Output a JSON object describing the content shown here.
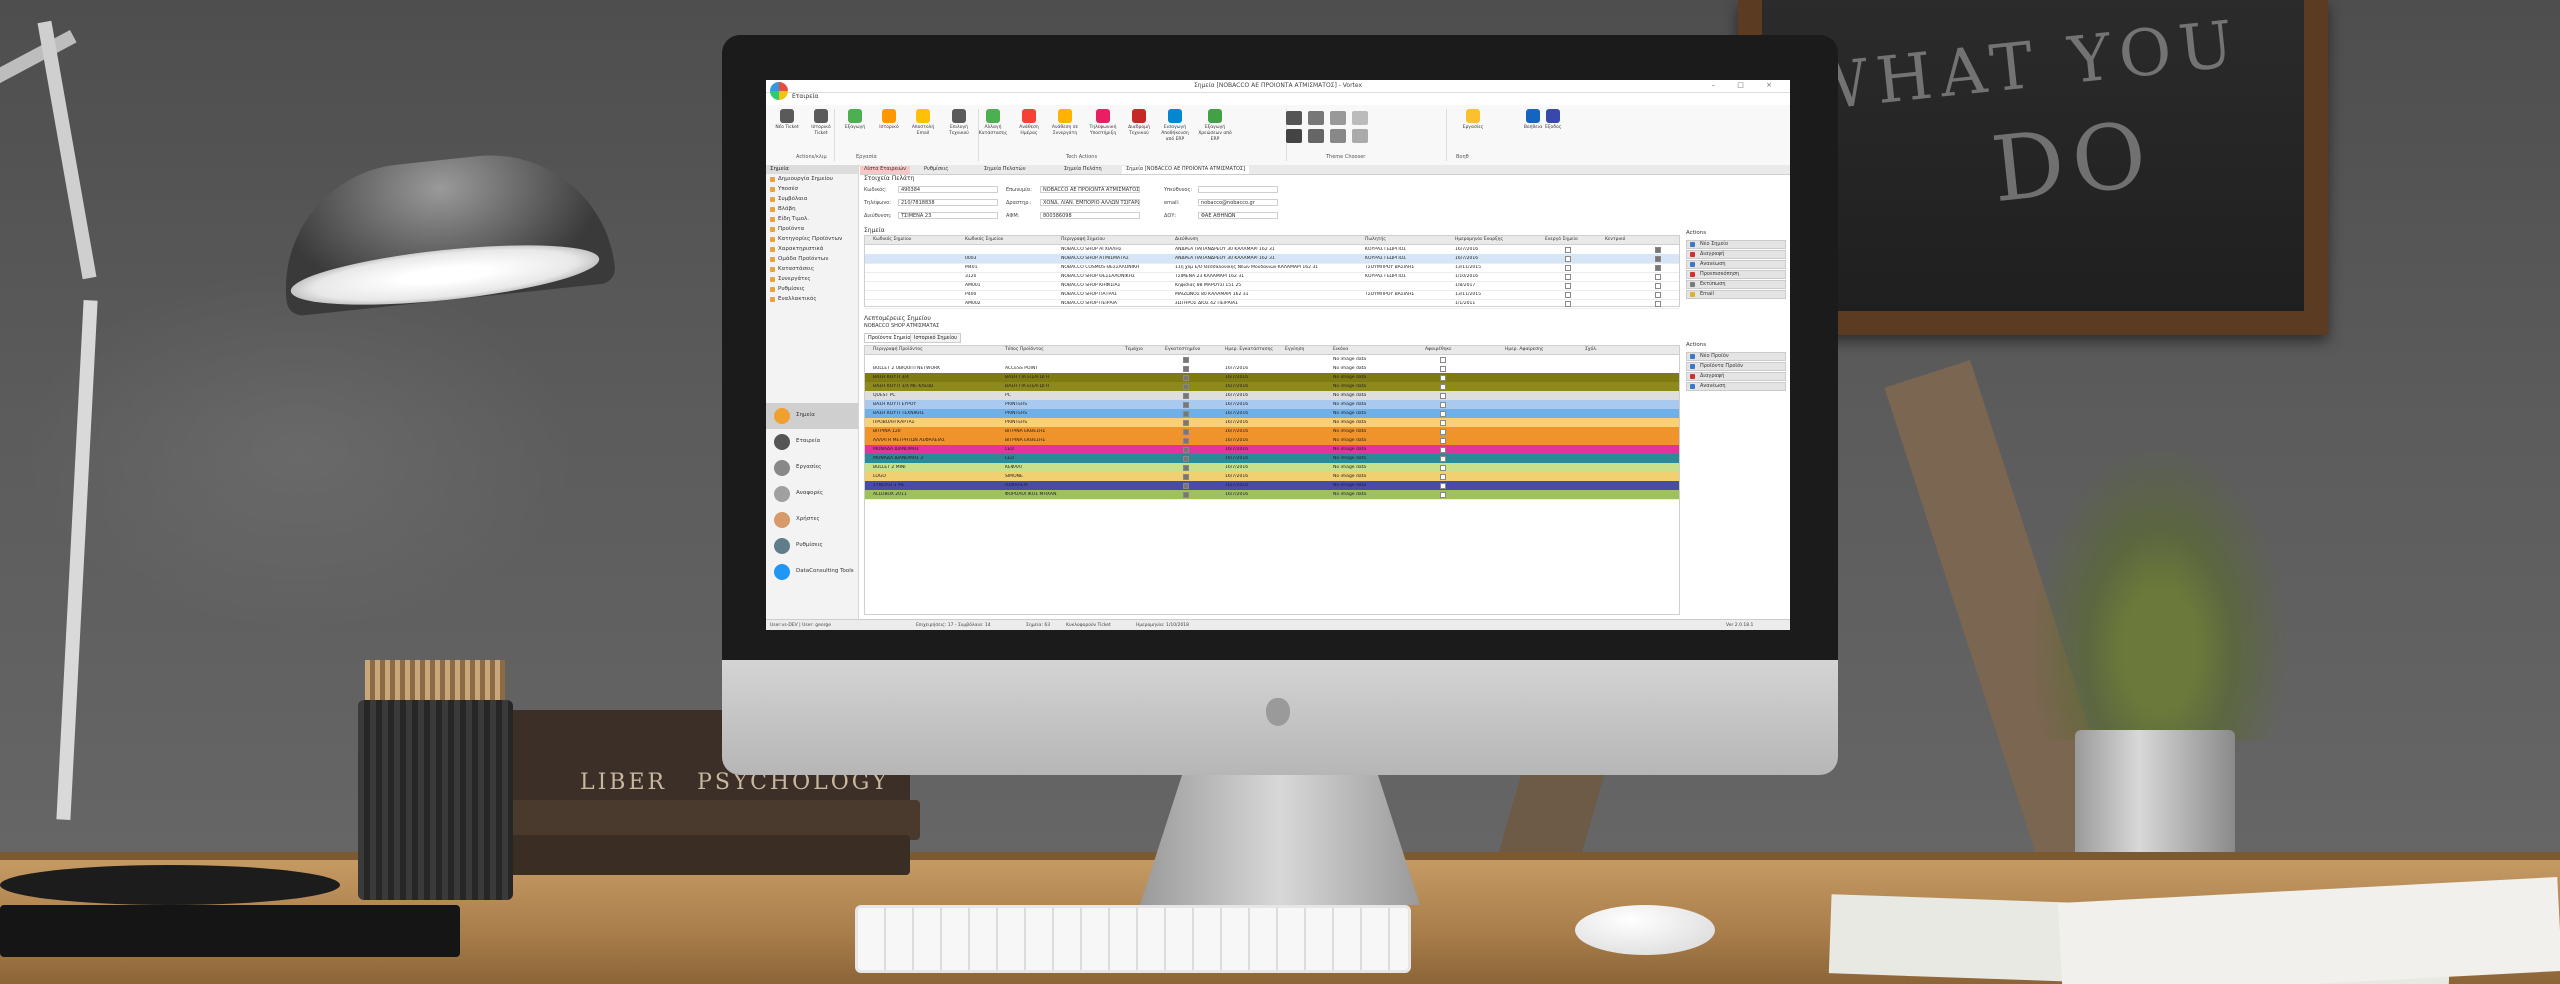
{
  "scene": {
    "chalkboard_text": [
      "WHAT YOU",
      "DO"
    ],
    "book_text": [
      "LIBER",
      "PSYCHOLOGY"
    ]
  },
  "app": {
    "window_title": "Σημεία [NOBACCO ΑΕ ΠΡΟΙΟΝΤΑ ΑΤΜΙΣΜΑΤΟΣ] - Vortex",
    "file_tab": "Εταιρεία",
    "ribbon_buttons": [
      {
        "label": "Νέο Ticket",
        "color": "#5a5a5a"
      },
      {
        "label": "Ιστορικό Ticket",
        "color": "#5a5a5a"
      },
      {
        "label": "Εξαγωγή",
        "color": "#4caf50"
      },
      {
        "label": "Ιστορικό",
        "color": "#ff9800"
      },
      {
        "label": "Αποστολή Email",
        "color": "#ffc107"
      },
      {
        "label": "Επιλογή Τεχνικού",
        "color": "#5a5a5a"
      },
      {
        "label": "Αλλαγή Κατάστασης",
        "color": "#4caf50"
      },
      {
        "label": "Ανάθεση Ημέρας",
        "color": "#f44336"
      },
      {
        "label": "Ανάθεση σε Συνεργάτη",
        "color": "#ffb300"
      },
      {
        "label": "Τηλεφωνική Υποστήριξη",
        "color": "#e91e63"
      },
      {
        "label": "Διαδρομή Τεχνικού",
        "color": "#c62828"
      },
      {
        "label": "Εισαγωγή Αποθήκευση από ERP",
        "color": "#0288d1"
      },
      {
        "label": "Εξαγωγή Χρεώσεων από ERP",
        "color": "#43a047"
      },
      {
        "label": "Εργασίες",
        "color": "#fbc02d"
      },
      {
        "label": "Βοήθεια",
        "color": "#1565c0"
      },
      {
        "label": "Έξοδος",
        "color": "#3949ab"
      }
    ],
    "ribbon_groups": [
      "Actions/κλιμ",
      "Εργασία",
      "Tech Actions",
      "Theme Chooser",
      "Βοηθ"
    ],
    "sidebar": {
      "head": "Σημεία",
      "items": [
        "Δημιουργία Σημείου",
        "Υποσέσ",
        "Συμβόλαια",
        "Βλάβη",
        "Είδη Τιμολ.",
        "Προϊόντα",
        "Κατηγορίες Προϊόντων",
        "Χαρακτηριστικά",
        "Ομάδα Προϊόντων",
        "Καταστάσεις",
        "Συνεργάτες",
        "Ρυθμίσεις",
        "Εναλλακτικός"
      ],
      "nav": [
        {
          "label": "Σημεία",
          "color": "#f0a030",
          "active": true
        },
        {
          "label": "Εταιρεία",
          "color": "#555555",
          "active": false
        },
        {
          "label": "Εργασίες",
          "color": "#888888",
          "active": false
        },
        {
          "label": "Αναφορές",
          "color": "#a0a0a0",
          "active": false
        },
        {
          "label": "Χρήστες",
          "color": "#d79a6a",
          "active": false
        },
        {
          "label": "Ρυθμίσεις",
          "color": "#607d8b",
          "active": false
        },
        {
          "label": "DataConsulting Tools",
          "color": "#2196f3",
          "active": false
        }
      ]
    },
    "doc_tabs": [
      "Λίστα Εταιρειών",
      "Ρυθμίσεις",
      "Σημεία Πελατών",
      "Σημεία Πελάτη",
      "Σημεία [NOBACCO ΑΕ ΠΡΟΙΟΝΤΑ ΑΤΜΙΣΜΑΤΟΣ]"
    ],
    "form": {
      "title": "Στοιχεία Πελάτη",
      "fields": [
        {
          "label": "Κωδικός:",
          "value": "490384"
        },
        {
          "label": "Επωνυμία:",
          "value": "NOBACCO ΑΕ ΠΡΟΙΟΝΤΑ ΑΤΜΙΣΜΑΤΟΣ"
        },
        {
          "label": "Υπεύθυνος:",
          "value": ""
        },
        {
          "label": "Τηλέφωνο:",
          "value": "210/7818838"
        },
        {
          "label": "Δραστηρ.:",
          "value": "ΧΟΝΔ. ΛΙΑΝ. ΕΜΠΟΡΙΟ ΑΛΛΩΝ ΤΣΙΓΑΡΩΝ"
        },
        {
          "label": "email:",
          "value": "nobacco@nobacco.gr"
        },
        {
          "label": "Διεύθυνση:",
          "value": "ΤΣΙΜΕΝΑ 23"
        },
        {
          "label": "ΑΦΜ:",
          "value": "800386098"
        },
        {
          "label": "ΔΟΥ:",
          "value": "ΦΑΕ ΑΘΗΝΩΝ"
        }
      ]
    },
    "points_label": "Σημεία",
    "points_headers": [
      "Κωδικός Σημείου",
      "Κωδικός Σημείου",
      "Περιγραφή Σημείου",
      "Διεύθυνση",
      "Πωλητής",
      "Ημερομηνία Έναρξης",
      "Ενεργό Σημείο",
      "Κεντρικό"
    ],
    "points_rows": [
      {
        "code": "",
        "code2": "",
        "name": "NOBACCO SHOP ΑΓΧΙΑΛΗΣ",
        "addr": "ΑΝΔΡΕΑ ΠΑΠΑΝΔΡΕΟΥ 30 ΚΑΛΑΜΑΡΙ 162 31",
        "seller": "ΚΟΥΡΑΣ ΓΕΩΡΓΙΟΣ",
        "date": "16/7/2016"
      },
      {
        "code": "",
        "code2": "0003",
        "name": "NOBACCO SHOP ΑΤΜΙΣΜΑΤΑΣ",
        "addr": "ΑΝΔΡΕΑ ΠΑΠΑΝΔΡΕΟΥ 30 ΚΑΛΑΜΑΡΙ 162 31",
        "seller": "ΚΟΥΡΑΣ ΓΕΩΡΓΙΟΣ",
        "date": "16/7/2016"
      },
      {
        "code": "",
        "code2": "M401",
        "name": "NOBACCO COSMOS ΘΕΣΣΑΛΟΝΙΚΗ",
        "addr": "11η χλμ Ε/Ο Θεσσαλονίκης Νέων Μουδανιών ΚΑΛΑΜΑΡΙ 162 31",
        "seller": "ΤΣΟΥΜΠΡΟΥ ΒΑΣΙΛΗΣ",
        "date": "13/11/2015"
      },
      {
        "code": "",
        "code2": "3120",
        "name": "NOBACCO SHOP ΘΕΣΣΑΛΟΝΙΚΗΣ",
        "addr": "ΤΣΙΜΕΝΑ 23 ΚΑΛΑΜΑΡΙ 162 31",
        "seller": "ΚΟΥΡΑΣ ΓΕΩΡΓΙΟΣ",
        "date": "1/10/2016"
      },
      {
        "code": "",
        "code2": "ΑΜ001",
        "name": "NOBACCO SHOP ΚΗΦΙΣΙΑΣ",
        "addr": "Κηφισίας 88 ΜΑΡΟΥΣΙ 151 25",
        "seller": "",
        "date": "1/8/2017"
      },
      {
        "code": "",
        "code2": "P400",
        "name": "NOBACCO SHOP ΠΑΤΡΑΣ",
        "addr": "ΜΑΙΖΩΝΟΣ 80 ΚΑΛΑΜΑΡΙ 162 31",
        "seller": "ΤΣΟΥΜΠΡΟΥ ΒΑΣΙΛΗΣ",
        "date": "13/11/2015"
      },
      {
        "code": "",
        "code2": "ΑΜ002",
        "name": "NOBACCO SHOP ΠΕΙΡΑΙΑ",
        "addr": "ΣΩΤΗΡΟΣ ΔΙΟΣ 42 ΠΕΙΡΑΙΑΣ",
        "seller": "",
        "date": "1/1/2011"
      }
    ],
    "details_label": "Λεπτομέρειες Σημείου",
    "details_name": "NOBACCO SHOP ΑΤΜΙΣΜΑΤΑΣ",
    "subtabs": [
      "Προϊόντα Σημείου",
      "Ιστορικό Σημείου"
    ],
    "products_headers": [
      "Περιγραφή Προϊόντος",
      "Τύπος Προϊόντος",
      "Τεμάχιο",
      "Εγκατεστημένο",
      "Ημερ. Εγκατάστασης",
      "Εγγύηση",
      "Εικόνα",
      "Αφαιρέθηκε",
      "Ημερ. Αφαίρεσης",
      "Σχόλ."
    ],
    "products_rows": [
      {
        "desc": "",
        "type": "",
        "date": "",
        "img": "No image data",
        "color": "#ffffff"
      },
      {
        "desc": "BULLET 2 UBIQUITI NETWORK",
        "type": "ACCESS POINT",
        "date": "16/7/2016",
        "img": "No image data",
        "color": "#ffffff"
      },
      {
        "desc": "ΒΑΣΗ ΚΟΥΤΙ 3/4",
        "type": "ΒΑΣΗ ΓΙΑ ΕΙΣΑΓΩΓΗ",
        "date": "16/7/2016",
        "img": "No image data",
        "color": "#7f7a12"
      },
      {
        "desc": "ΒΑΣΗ ΚΟΥΤΙ 3/4 ΜΕ ΚΛΕΙΔΙ",
        "type": "ΒΑΣΗ ΓΙΑ ΕΙΣΑΓΩΓΗ",
        "date": "16/7/2016",
        "img": "No image data",
        "color": "#8e8a1a"
      },
      {
        "desc": "QUEST PC",
        "type": "PC",
        "date": "16/7/2016",
        "img": "No image data",
        "color": "#dedede"
      },
      {
        "desc": "ΒΑΣΗ ΚΟΥΤΙ ΕΥΡΟΥ",
        "type": "PRINTERS",
        "date": "16/7/2016",
        "img": "No image data",
        "color": "#a9c9ef"
      },
      {
        "desc": "ΒΑΣΗ ΚΟΥΤΙ ΤΕΧΝΙΚΗΣ",
        "type": "PRINTERS",
        "date": "16/7/2016",
        "img": "No image data",
        "color": "#6fb0e8"
      },
      {
        "desc": "ΠΡΟΒΟΛΗ ΚΑΡΤΑΣ",
        "type": "PRINTERS",
        "date": "16/7/2016",
        "img": "No image data",
        "color": "#f5d278"
      },
      {
        "desc": "ΒΙΤΡΙΝΑ 120",
        "type": "ΒΙΤΡΙΝΑ ΕΚΘΕΣΗΣ",
        "date": "16/7/2016",
        "img": "No image data",
        "color": "#f0932b"
      },
      {
        "desc": "ΑΛΛΑΓΗ ΜΕΤΡΗΤΩΝ ΑΣΦΑΛΕΙΑΣ",
        "type": "ΒΙΤΡΙΝΑ ΕΚΘΕΣΗΣ",
        "date": "16/7/2016",
        "img": "No image data",
        "color": "#f0932b"
      },
      {
        "desc": "ΜΟΝΑΔΑ ΔΙΑΝΟΜΗΣ",
        "type": "LED",
        "date": "16/7/2016",
        "img": "No image data",
        "color": "#e0359a"
      },
      {
        "desc": "ΜΟΝΑΔΑ ΔΙΑΝΟΜΗΣ 2",
        "type": "LED",
        "date": "16/7/2016",
        "img": "No image data",
        "color": "#2a8a9a"
      },
      {
        "desc": "BULLET 2 MINI",
        "type": "ΚΕΦΑΛΙ",
        "date": "16/7/2016",
        "img": "No image data",
        "color": "#c8e08a"
      },
      {
        "desc": "LOGO",
        "type": "SIMONE",
        "date": "16/7/2016",
        "img": "No image data",
        "color": "#f0d070"
      },
      {
        "desc": "ΣΥΝΟΛΟ 3 ΜΕ",
        "type": "ΑΣΦΑΛΕΙΑ",
        "date": "16/7/2016",
        "img": "No image data",
        "color": "#4a4aa8"
      },
      {
        "desc": "ALLOBOX 2011",
        "type": "ΦΟΡΟΛΟΓΙΚΟΣ ΜΗΧΑΝ.",
        "date": "16/7/2016",
        "img": "No image data",
        "color": "#a0c060"
      }
    ],
    "actions_top": {
      "head": "Actions",
      "buttons": [
        {
          "label": "Νέο Σημείο",
          "color": "#3a78c8"
        },
        {
          "label": "Διαγραφή",
          "color": "#d32f2f"
        },
        {
          "label": "Ανανέωση",
          "color": "#3a78c8"
        },
        {
          "label": "Προεπισκόπηση",
          "color": "#d32f2f"
        },
        {
          "label": "Εκτύπωση",
          "color": "#7a7a7a"
        },
        {
          "label": "Email",
          "color": "#e0b030"
        }
      ]
    },
    "actions_bottom": {
      "head": "Actions",
      "buttons": [
        {
          "label": "Νέο Προϊόν",
          "color": "#3a78c8"
        },
        {
          "label": "Προϊόντα Προϊόν",
          "color": "#3a78c8"
        },
        {
          "label": "Διαγραφή",
          "color": "#d32f2f"
        },
        {
          "label": "Ανανέωση",
          "color": "#3a78c8"
        }
      ]
    },
    "status": [
      "User:vs-DEV | User: george",
      "Επιχειρήσεις: 17 - Συμβόλαια: 14",
      "Σημεία: 63",
      "Κυκλοφορούν Ticket",
      "Ημερομηνία: 1/10/2018",
      "Ver 2.0.18.1"
    ]
  }
}
